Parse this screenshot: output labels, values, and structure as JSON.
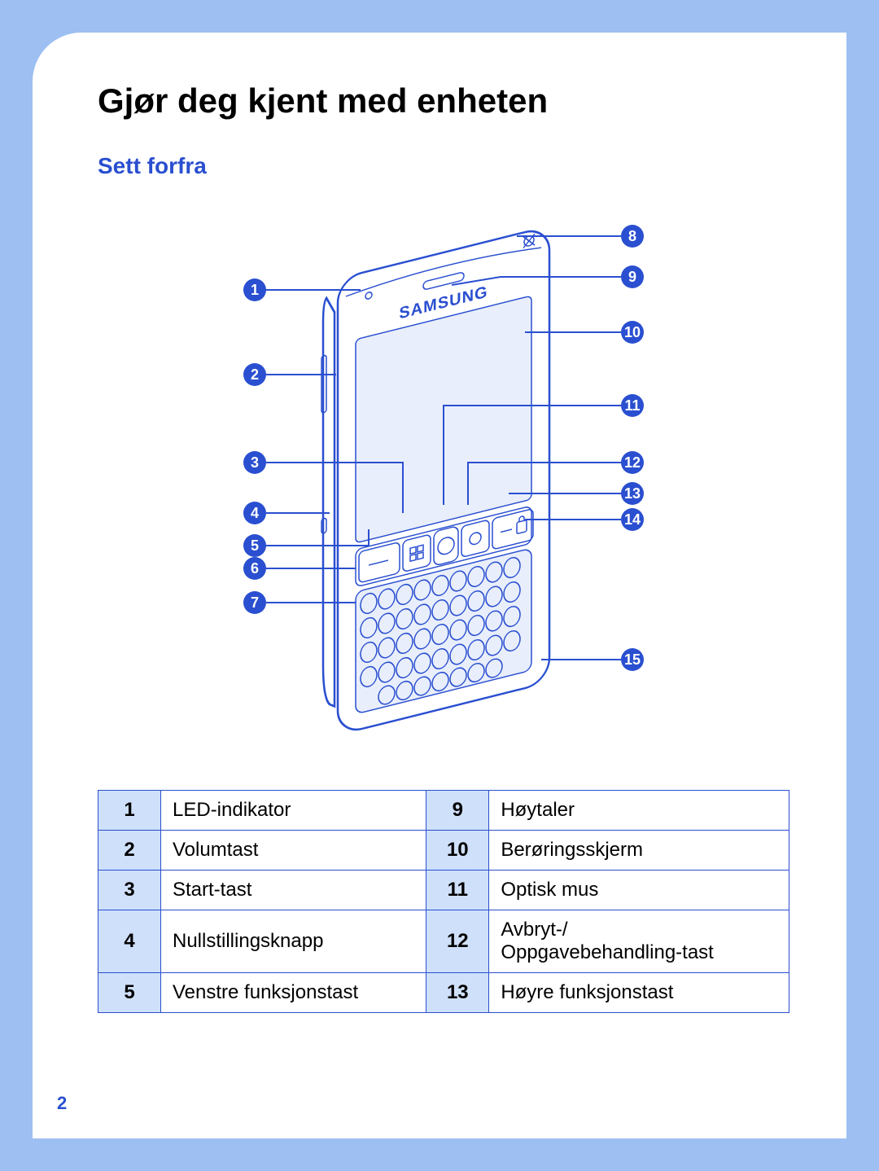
{
  "page_number": "2",
  "title": "Gjør deg kjent med enheten",
  "subtitle": "Sett forfra",
  "brand": "SAMSUNG",
  "callouts_left": [
    "1",
    "2",
    "3",
    "4",
    "5",
    "6",
    "7"
  ],
  "callouts_right": [
    "8",
    "9",
    "10",
    "11",
    "12",
    "13",
    "14",
    "15"
  ],
  "legend": [
    {
      "n": "1",
      "label": "LED-indikator"
    },
    {
      "n": "2",
      "label": "Volumtast"
    },
    {
      "n": "3",
      "label": "Start-tast"
    },
    {
      "n": "4",
      "label": "Nullstillingsknapp"
    },
    {
      "n": "5",
      "label": "Venstre funksjonstast"
    },
    {
      "n": "9",
      "label": "Høytaler"
    },
    {
      "n": "10",
      "label": "Berøringsskjerm"
    },
    {
      "n": "11",
      "label": "Optisk mus"
    },
    {
      "n": "12",
      "label": "Avbryt-/\nOppgavebehandling-tast"
    },
    {
      "n": "13",
      "label": "Høyre funksjonstast"
    }
  ]
}
